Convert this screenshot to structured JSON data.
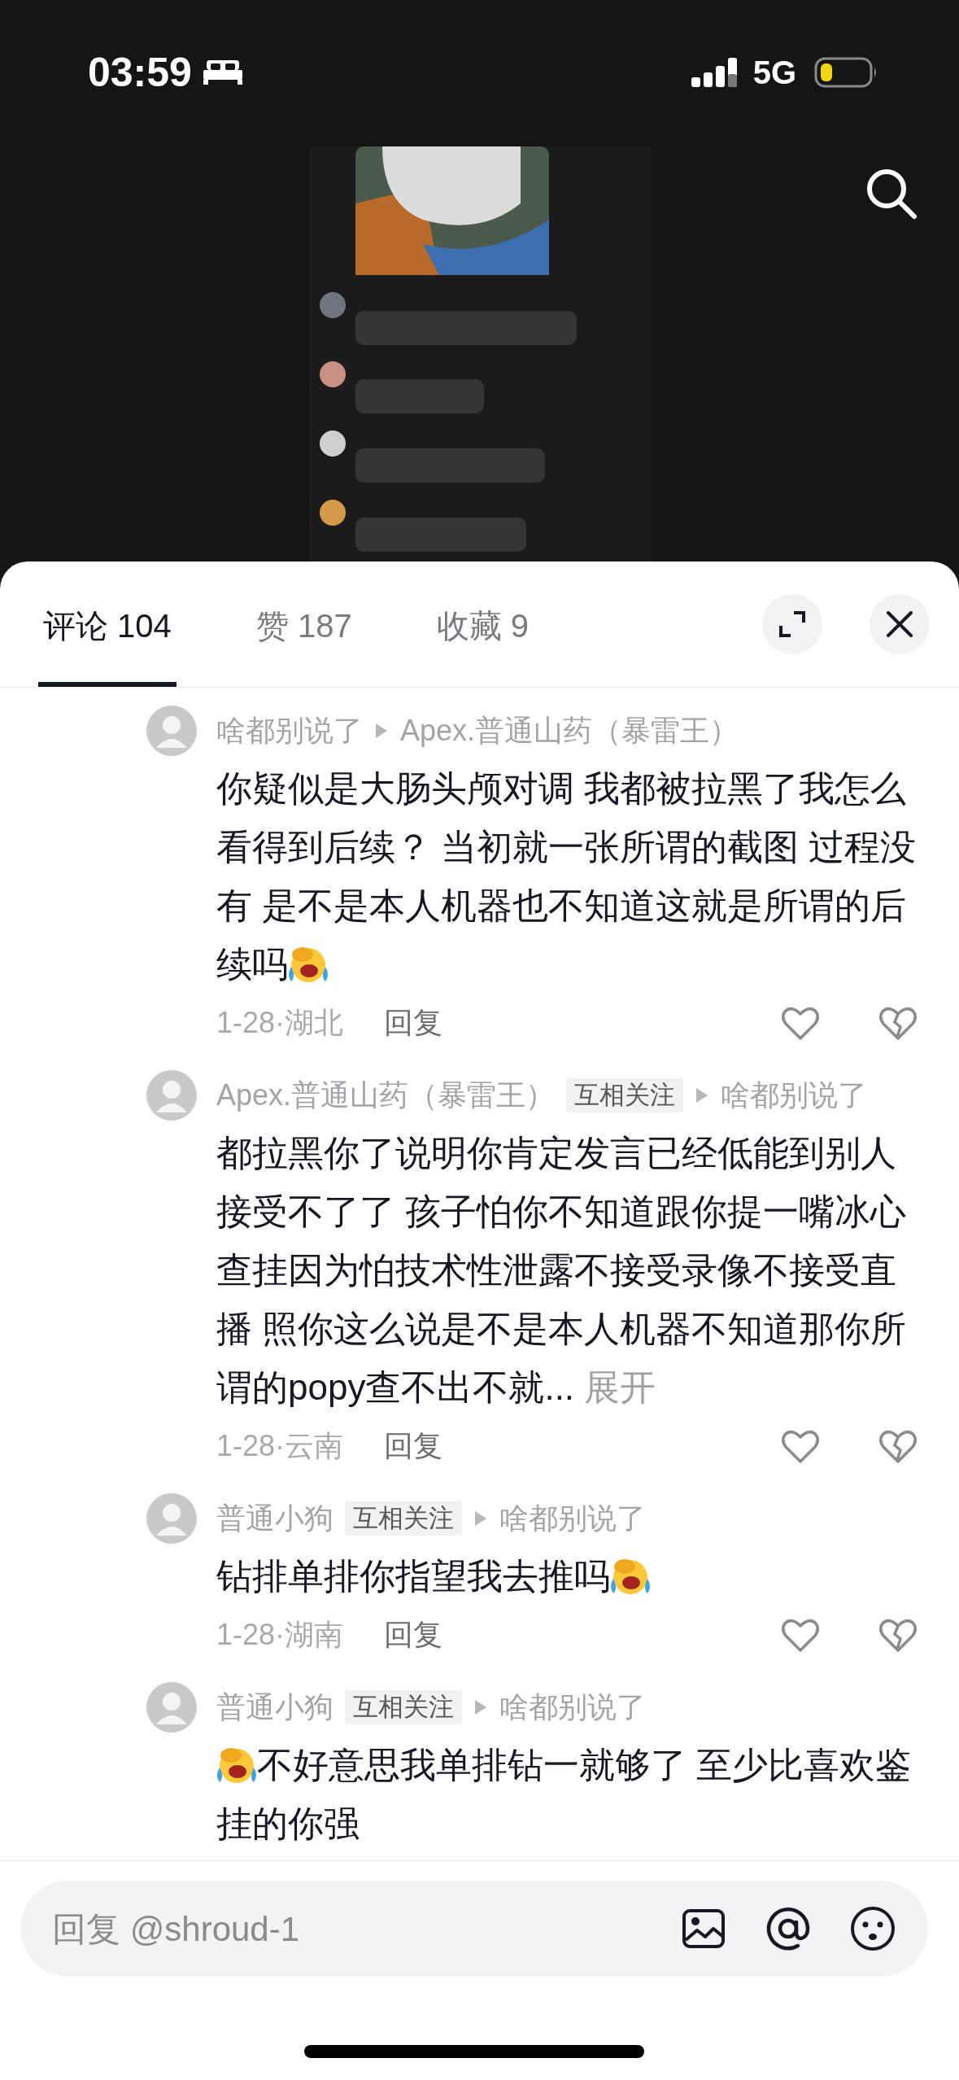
{
  "status_bar": {
    "time": "03:59",
    "network": "5G"
  },
  "tabs": [
    {
      "label": "评论 104",
      "selected": true
    },
    {
      "label": "赞 187",
      "selected": false
    },
    {
      "label": "收藏 9",
      "selected": false
    }
  ],
  "comments": [
    {
      "author": "啥都别说了",
      "reply_to": "Apex.普通山药（暴雷王）",
      "body": [
        {
          "kind": "text",
          "text": "你疑似是大肠头颅对调 我都被拉黑了我怎么看得到后续？ 当初就一张所谓的截图 过程没有 是不是本人机器也不知道这就是所谓的后续吗"
        },
        {
          "kind": "emoji"
        }
      ],
      "date_location": "1-28·湖北",
      "reply_label": "回复"
    },
    {
      "author": "Apex.普通山药（暴雷王）",
      "tag": "互相关注",
      "reply_to": "啥都别说了",
      "body": [
        {
          "kind": "text",
          "text": "都拉黑你了说明你肯定发言已经低能到别人接受不了了 孩子怕你不知道跟你提一嘴冰心查挂因为怕技术性泄露不接受录像不接受直播 照你这么说是不是本人机器不知道那你所谓的popy查不出不就..."
        },
        {
          "kind": "link",
          "text": "展开"
        }
      ],
      "date_location": "1-28·云南",
      "reply_label": "回复"
    },
    {
      "author": "普通小狗",
      "tag": "互相关注",
      "reply_to": "啥都别说了",
      "body": [
        {
          "kind": "text",
          "text": "钻排单排你指望我去推吗"
        },
        {
          "kind": "emoji"
        }
      ],
      "date_location": "1-28·湖南",
      "reply_label": "回复"
    },
    {
      "author": "普通小狗",
      "tag": "互相关注",
      "reply_to": "啥都别说了",
      "body": [
        {
          "kind": "emoji"
        },
        {
          "kind": "text",
          "text": "不好意思我单排钻一就够了 至少比喜欢鉴挂的你强"
        }
      ]
    }
  ],
  "reply_box": {
    "placeholder": "回复 @shroud-1"
  }
}
